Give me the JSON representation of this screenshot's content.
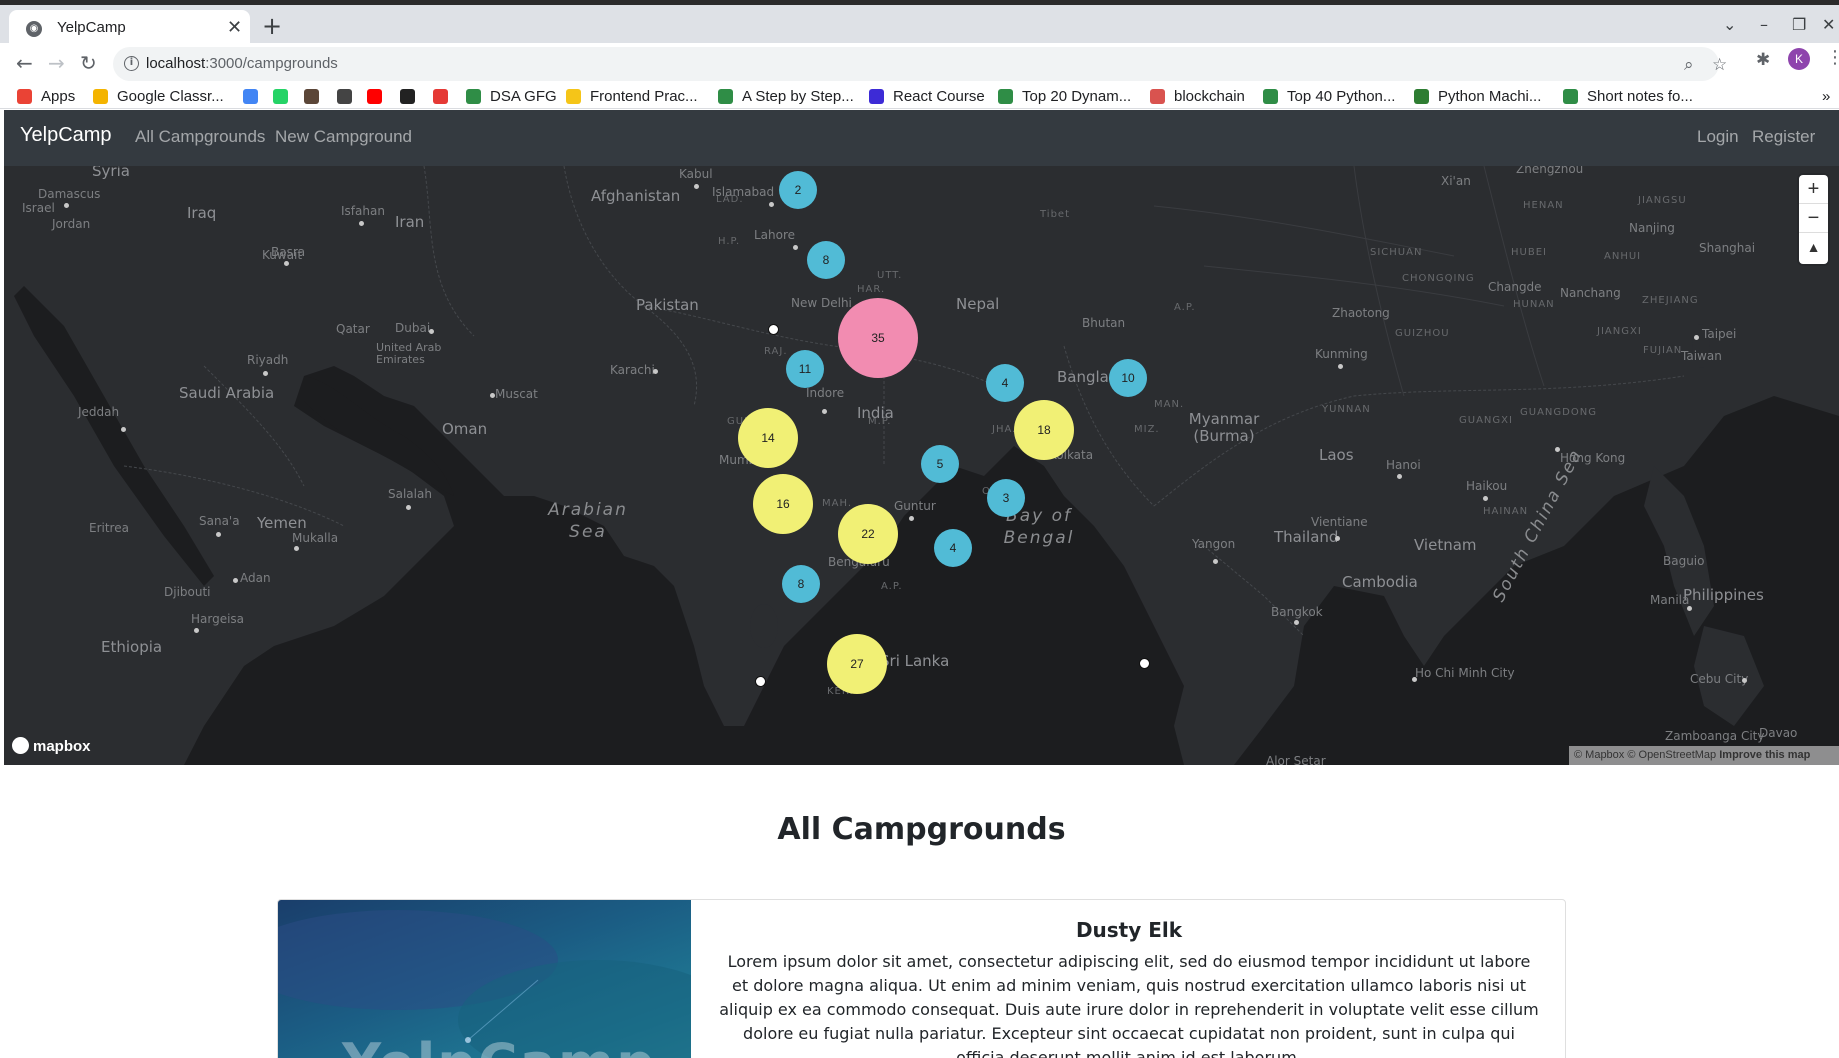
{
  "browser": {
    "tab_title": "YelpCamp",
    "url_host": "localhost",
    "url_path": ":3000/campgrounds",
    "profile_initial": "K"
  },
  "bookmarks": [
    {
      "label": "Apps",
      "icon": "apps-grid-icon",
      "color": "#ea4335"
    },
    {
      "label": "Google Classr...",
      "icon": "classroom-icon",
      "color": "#f4b400"
    },
    {
      "label": "",
      "icon": "drive-icon",
      "color": "#4285f4"
    },
    {
      "label": "",
      "icon": "whatsapp-icon",
      "color": "#25d366"
    },
    {
      "label": "",
      "icon": "codechef-icon",
      "color": "#5b4638"
    },
    {
      "label": "",
      "icon": "qr-icon",
      "color": "#444444"
    },
    {
      "label": "",
      "icon": "youtube-icon",
      "color": "#ff0000"
    },
    {
      "label": "",
      "icon": "github-icon",
      "color": "#222222"
    },
    {
      "label": "",
      "icon": "coursera-icon",
      "color": "#e53935"
    },
    {
      "label": "DSA GFG",
      "icon": "gfg-icon",
      "color": "#2f8d46"
    },
    {
      "label": "Frontend Prac...",
      "icon": "crown-icon",
      "color": "#f5c518"
    },
    {
      "label": "A Step by Step...",
      "icon": "gfg-icon",
      "color": "#2f8d46"
    },
    {
      "label": "React Course",
      "icon": "react-course-icon",
      "color": "#3d2bd6"
    },
    {
      "label": "Top 20 Dynam...",
      "icon": "gfg-icon",
      "color": "#2f8d46"
    },
    {
      "label": "blockchain",
      "icon": "blockchain-icon",
      "color": "#d9534f"
    },
    {
      "label": "Top 40 Python...",
      "icon": "gfg-icon",
      "color": "#2f8d46"
    },
    {
      "label": "Python Machi...",
      "icon": "w-icon",
      "color": "#2e7d32"
    },
    {
      "label": "Short notes fo...",
      "icon": "gfg-icon",
      "color": "#2f8d46"
    }
  ],
  "navbar": {
    "brand": "YelpCamp",
    "links": [
      "All Campgrounds",
      "New Campground"
    ],
    "right_links": [
      "Login",
      "Register"
    ]
  },
  "map": {
    "countries": [
      "Syria",
      "Iraq",
      "Iran",
      "Afghanistan",
      "Pakistan",
      "Nepal",
      "Bhutan",
      "India",
      "Bangladesh",
      "Saudi Arabia",
      "Oman",
      "Yemen",
      "Eritrea",
      "Djibouti",
      "Ethiopia",
      "Sri Lanka",
      "Myanmar (Burma)",
      "Laos",
      "Thailand",
      "Vietnam",
      "Cambodia",
      "Philippines",
      "Taiwan",
      "Kuwait",
      "Qatar",
      "United Arab Emirates",
      "Jordan",
      "Israel",
      "Tibet"
    ],
    "seas": [
      "Arabian Sea",
      "Bay of Bengal",
      "South China Sea"
    ],
    "cities": [
      "Damascus",
      "Isfahan",
      "Basra",
      "Kabul",
      "Islamabad",
      "Lahore",
      "New Delhi",
      "Riyadh",
      "Dubai",
      "Karachi",
      "Muscat",
      "Jeddah",
      "Indore",
      "Mumbai",
      "Sana'a",
      "Mukalla",
      "Salalah",
      "Adan",
      "Hargeisa",
      "Guntur",
      "Bengaluru",
      "Kolkata",
      "Kunming",
      "Hanoi",
      "Haikou",
      "Hong Kong",
      "Vientiane",
      "Yangon",
      "Bangkok",
      "Ho Chi Minh City",
      "Manila",
      "Baguio",
      "Cebu City",
      "Zamboanga City",
      "Davao",
      "Zhengzhou",
      "Xi'an",
      "Nanjing",
      "Shanghai",
      "Changde",
      "Nanchang",
      "Zhaotong",
      "Taipei",
      "Alor Setar"
    ],
    "regions": [
      "LAD.",
      "H.P.",
      "UTT.",
      "HAR.",
      "RAJ.",
      "M.P.",
      "GUJ.",
      "MAH.",
      "JHA.",
      "OD.",
      "A.P.",
      "KER.",
      "MIZ.",
      "MAN.",
      "A.P.",
      "HENAN",
      "JIANGSU",
      "ANHUI",
      "HUBEI",
      "SICHUAN",
      "CHONGQING",
      "HUNAN",
      "JIANGXI",
      "ZHEJIANG",
      "GUIZHOU",
      "FUJIAN",
      "YUNNAN",
      "GUANGXI",
      "GUANGDONG",
      "HAINAN"
    ],
    "clusters": [
      {
        "count": "2",
        "color": "#51bbd6"
      },
      {
        "count": "8",
        "color": "#51bbd6"
      },
      {
        "count": "35",
        "color": "#f28cb1"
      },
      {
        "count": "11",
        "color": "#51bbd6"
      },
      {
        "count": "4",
        "color": "#51bbd6"
      },
      {
        "count": "10",
        "color": "#51bbd6"
      },
      {
        "count": "14",
        "color": "#f1f075"
      },
      {
        "count": "18",
        "color": "#f1f075"
      },
      {
        "count": "5",
        "color": "#51bbd6"
      },
      {
        "count": "16",
        "color": "#f1f075"
      },
      {
        "count": "3",
        "color": "#51bbd6"
      },
      {
        "count": "22",
        "color": "#f1f075"
      },
      {
        "count": "4",
        "color": "#51bbd6"
      },
      {
        "count": "8",
        "color": "#51bbd6"
      },
      {
        "count": "27",
        "color": "#f1f075"
      }
    ],
    "zoom_in": "+",
    "zoom_out": "−",
    "compass": "▲",
    "logo_text": "mapbox",
    "attribution": "© Mapbox © OpenStreetMap",
    "improve": "Improve this map"
  },
  "content": {
    "heading": "All Campgrounds",
    "card": {
      "title": "Dusty Elk",
      "description": "Lorem ipsum dolor sit amet, consectetur adipiscing elit, sed do eiusmod tempor incididunt ut labore et dolore magna aliqua. Ut enim ad minim veniam, quis nostrud exercitation ullamco laboris nisi ut aliquip ex ea commodo consequat. Duis aute irure dolor in reprehenderit in voluptate velit esse cillum dolore eu fugiat nulla pariatur. Excepteur sint occaecat cupidatat non proident, sunt in culpa qui officia deserunt mollit anim id est laborum.",
      "image_watermark": "YelpCamp"
    }
  }
}
